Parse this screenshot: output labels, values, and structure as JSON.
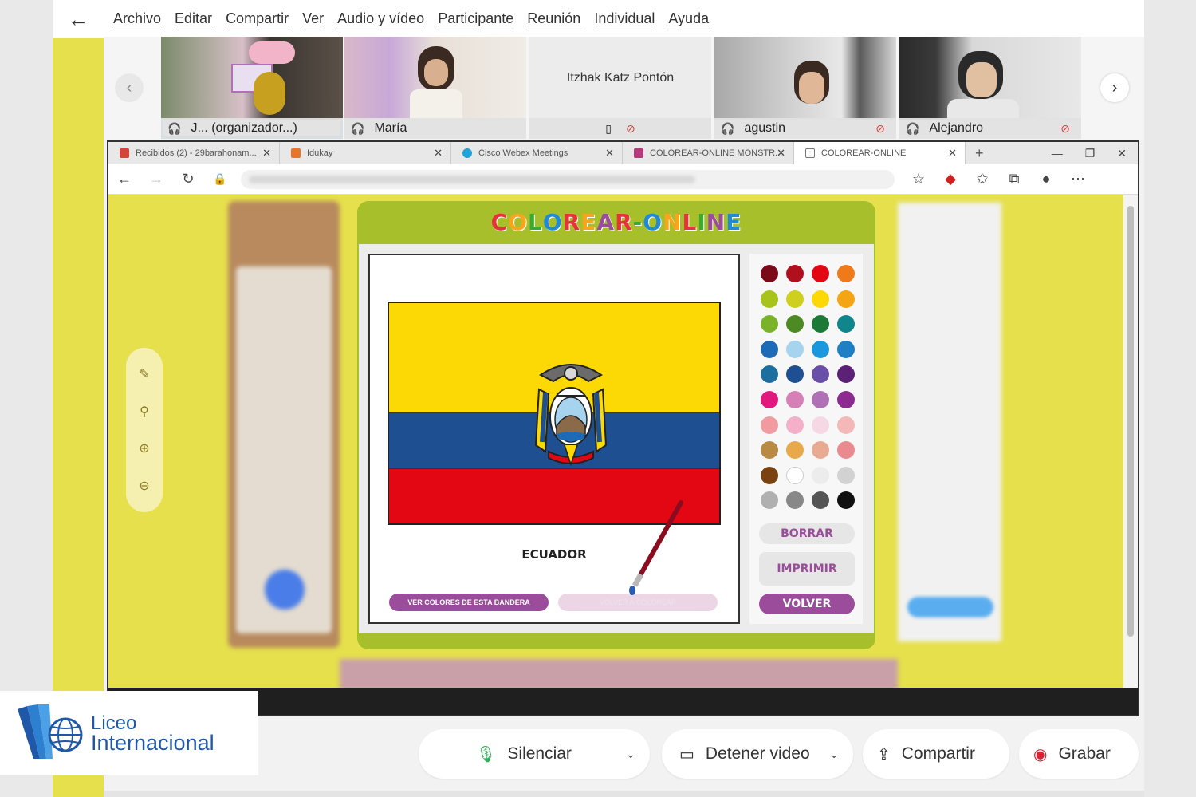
{
  "menu": [
    "Archivo",
    "Editar",
    "Compartir",
    "Ver",
    "Audio y vídeo",
    "Participante",
    "Reunión",
    "Individual",
    "Ayuda"
  ],
  "participants": [
    {
      "name": "J... (organizador...)",
      "active": true,
      "muted": false
    },
    {
      "name": "María",
      "active": false,
      "muted": false
    },
    {
      "name": "Itzhak Katz Pontón",
      "active": false,
      "muted": true
    },
    {
      "name": "agustin",
      "active": false,
      "muted": true
    },
    {
      "name": "Alejandro",
      "active": false,
      "muted": true
    }
  ],
  "browser": {
    "tabs": [
      {
        "title": "Recibidos (2) - 29barahonam...",
        "favicon": "gmail-icon",
        "color": "#d44638"
      },
      {
        "title": "Idukay",
        "favicon": "idukay-icon",
        "color": "#e8742a"
      },
      {
        "title": "Cisco Webex Meetings",
        "favicon": "webex-icon",
        "color": "#1fa3d8"
      },
      {
        "title": "COLOREAR-ONLINE MONSTR...",
        "favicon": "colorear-icon",
        "color": "#b53a7c"
      },
      {
        "title": "COLOREAR-ONLINE",
        "favicon": "page-icon",
        "color": "#ffffff"
      }
    ]
  },
  "app": {
    "title": "COLOREAR-ONLINE",
    "title_colors": [
      "#e8323a",
      "#f7a51c",
      "#3aaa35",
      "#1f8bd6",
      "#e8323a",
      "#f7a51c",
      "#9b4c9b",
      "#e8323a",
      "#3aaa35",
      "#1f8bd6",
      "#f7a51c",
      "#e8323a",
      "#3aaa35",
      "#9b4c9b",
      "#1f8bd6"
    ],
    "country": "ECUADOR",
    "btn_colors": "VER COLORES DE ESTA BANDERA",
    "btn_recolor": "VOLVER A COLOREAR",
    "btn_clear": "BORRAR",
    "btn_print": "IMPRIMIR",
    "btn_back": "VOLVER",
    "palette": [
      "#7a0a17",
      "#b0101e",
      "#e30613",
      "#ee7a1a",
      "#a8c41c",
      "#cfcf1e",
      "#fcd904",
      "#f3a612",
      "#7ab32a",
      "#4e8a24",
      "#1a7a36",
      "#10858c",
      "#1d6ab7",
      "#a6d4ee",
      "#1b97dd",
      "#1f7fc4",
      "#1c6e9e",
      "#1d4f91",
      "#6a4fa8",
      "#5a2175",
      "#e3187e",
      "#d680b8",
      "#b070b6",
      "#8d2a8f",
      "#f19aa0",
      "#f4b0c8",
      "#f6d8e4",
      "#f4b8b8",
      "#b88a44",
      "#e8a94a",
      "#e8aa90",
      "#e88a8e",
      "#7a4210",
      "#ffffff",
      "#ececec",
      "#d2d2d2",
      "#b0b0b0",
      "#888888",
      "#555555",
      "#111111"
    ]
  },
  "controls": {
    "mute": "Silenciar",
    "video": "Detener video",
    "share": "Compartir",
    "record": "Grabar"
  },
  "logo": {
    "line1": "Liceo",
    "line2": "Internacional"
  }
}
